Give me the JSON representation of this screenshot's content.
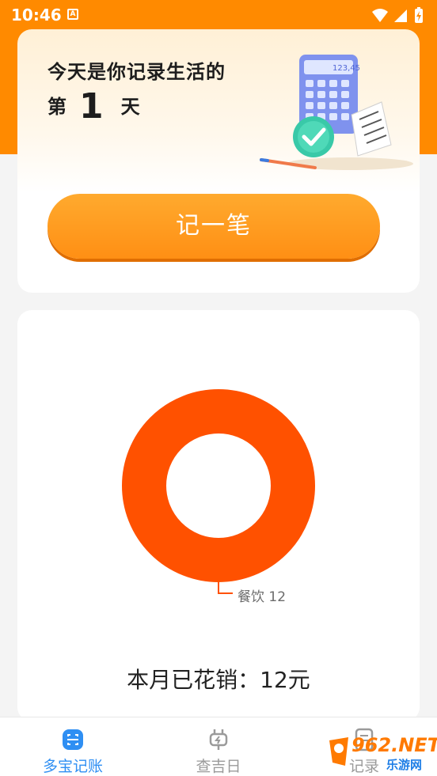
{
  "status_bar": {
    "time": "10:46",
    "notification_icon": "A",
    "icons": [
      "wifi-icon",
      "signal-icon",
      "battery-icon"
    ]
  },
  "hero": {
    "line1": "今天是你记录生活的",
    "day_prefix": "第",
    "day_count": "1",
    "day_suffix": "天",
    "illustration_digits": "123,45",
    "record_button": "记一笔"
  },
  "chart_data": {
    "type": "pie",
    "style": "donut",
    "categories": [
      "餐饮"
    ],
    "values": [
      12
    ],
    "colors": [
      "#ff5100"
    ],
    "legend_label": "餐饮 12"
  },
  "summary": {
    "monthly_total": "本月已花销：12元"
  },
  "tab_bar": {
    "tabs": [
      {
        "label": "多宝记账",
        "icon": "scan-icon",
        "active": true
      },
      {
        "label": "查吉日",
        "icon": "plug-icon",
        "active": false
      },
      {
        "label": "记录",
        "icon": "list-icon",
        "active": false
      }
    ]
  },
  "watermark": {
    "text": "962.NET",
    "sub": "乐游网"
  },
  "colors": {
    "brand_orange": "#ff8a00",
    "chart_orange": "#ff5100",
    "tab_active_blue": "#2f8ff3"
  }
}
